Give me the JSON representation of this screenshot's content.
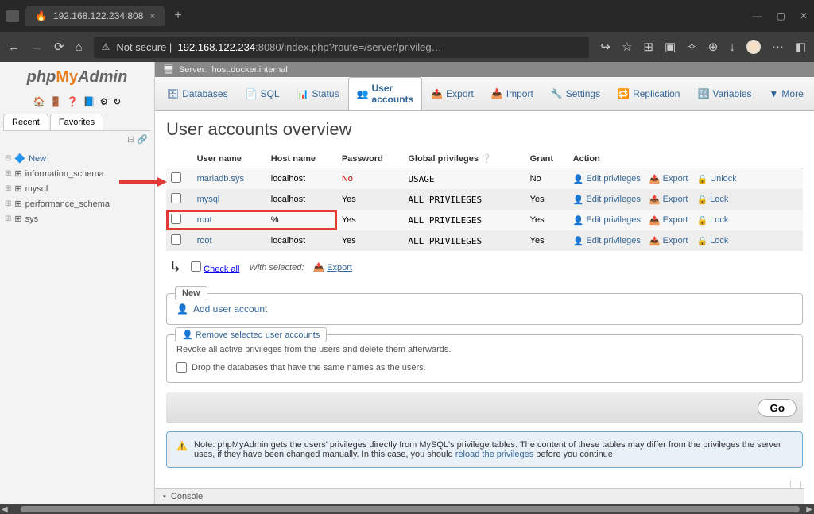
{
  "browser": {
    "tab_title": "192.168.122.234:808",
    "url_notsecure": "Not secure",
    "url_host": "192.168.122.234",
    "url_port": ":8080",
    "url_path": "/index.php?route=/server/privileg…"
  },
  "logo": {
    "php": "php",
    "my": "My",
    "admin": "Admin"
  },
  "sidebar": {
    "tabs": {
      "recent": "Recent",
      "favorites": "Favorites"
    },
    "new": "New",
    "items": [
      "information_schema",
      "mysql",
      "performance_schema",
      "sys"
    ]
  },
  "breadcrumb": {
    "server_label": "Server:",
    "server": "host.docker.internal"
  },
  "tabs": {
    "databases": "Databases",
    "sql": "SQL",
    "status": "Status",
    "users": "User accounts",
    "export": "Export",
    "import": "Import",
    "settings": "Settings",
    "replication": "Replication",
    "variables": "Variables",
    "more": "More"
  },
  "page": {
    "title": "User accounts overview",
    "cols": {
      "user": "User name",
      "host": "Host name",
      "password": "Password",
      "global": "Global privileges",
      "grant": "Grant",
      "action": "Action"
    },
    "rows": [
      {
        "user": "mariadb.sys",
        "host": "localhost",
        "pw": "No",
        "pw_red": true,
        "priv": "USAGE",
        "grant": "No"
      },
      {
        "user": "mysql",
        "host": "localhost",
        "pw": "Yes",
        "priv": "ALL PRIVILEGES",
        "grant": "Yes"
      },
      {
        "user": "root",
        "host": "%",
        "pw": "Yes",
        "priv": "ALL PRIVILEGES",
        "grant": "Yes",
        "highlight": true
      },
      {
        "user": "root",
        "host": "localhost",
        "pw": "Yes",
        "priv": "ALL PRIVILEGES",
        "grant": "Yes"
      }
    ],
    "actions": {
      "edit": "Edit privileges",
      "export": "Export",
      "unlock": "Unlock",
      "lock": "Lock"
    },
    "checkall": "Check all",
    "withselected": "With selected:",
    "export_sel": "Export",
    "new_legend": "New",
    "add_user": "Add user account",
    "remove_legend": "Remove selected user accounts",
    "remove_desc": "Revoke all active privileges from the users and delete them afterwards.",
    "drop_db": "Drop the databases that have the same names as the users.",
    "go": "Go",
    "note": "Note: phpMyAdmin gets the users' privileges directly from MySQL's privilege tables. The content of these tables may differ from the privileges the server uses, if they have been changed manually. In this case, you should ",
    "note_link": "reload the privileges",
    "note_after": " before you continue.",
    "console": "Console"
  }
}
